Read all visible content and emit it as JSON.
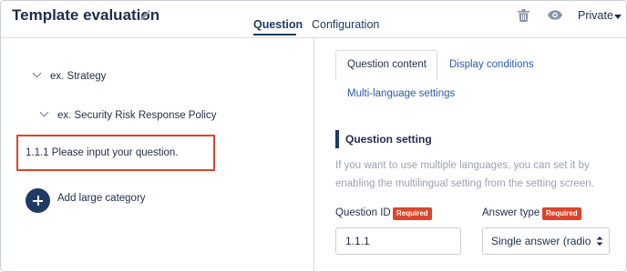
{
  "header": {
    "title": "Template evaluation",
    "tabs": [
      {
        "label": "Question",
        "active": true
      },
      {
        "label": "Configuration",
        "active": false
      }
    ],
    "privacy": "Private"
  },
  "tree": {
    "category": "ex. Strategy",
    "subcategory": "ex. Security Risk Response Policy",
    "selected_question": "1.1.1  Please input your question.",
    "add_label": "Add large category"
  },
  "panel": {
    "tabs": {
      "question_content": "Question content",
      "display_conditions": "Display conditions",
      "multi_language": "Multi-language settings"
    },
    "section_title": "Question setting",
    "hint": "If you want to use multiple languages, you can set it by enabling the multilingual setting from the setting screen.",
    "question_id_label": "Question ID",
    "answer_type_label": "Answer type",
    "required_badge": "Required",
    "question_id_value": "1.1.1",
    "answer_type_value": "Single answer (radio"
  },
  "colors": {
    "navy": "#1f3a64",
    "required_red": "#d9462b",
    "highlight_border": "#d9462b",
    "link_blue": "#2a5aa6",
    "hint_gray": "#9aa2b1"
  },
  "icons": [
    "pencil-icon",
    "trash-icon",
    "eye-icon",
    "chevron-down-icon",
    "plus-icon"
  ]
}
